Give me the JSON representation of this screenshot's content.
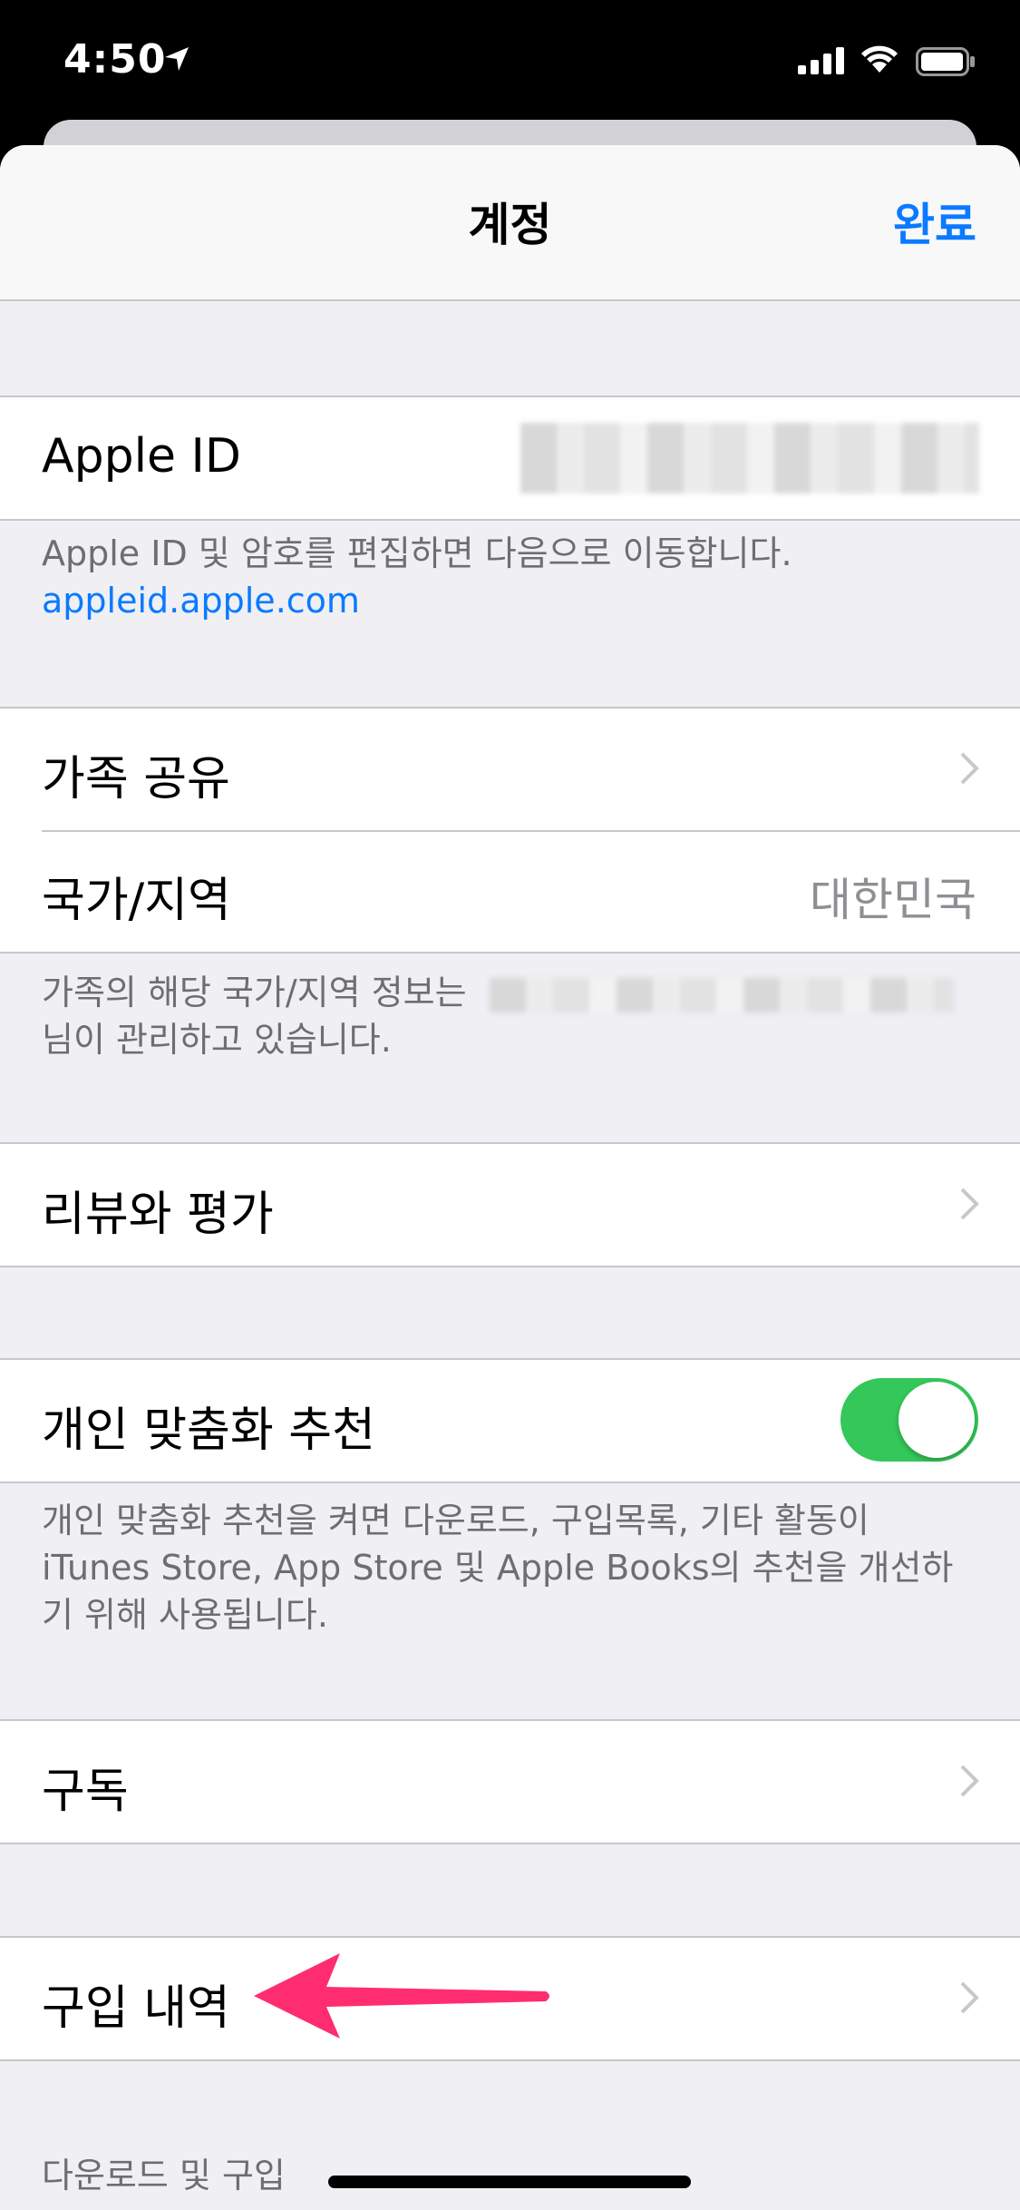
{
  "status_bar": {
    "time": "4:50"
  },
  "nav": {
    "title": "계정",
    "done": "완료"
  },
  "apple_id": {
    "label": "Apple ID",
    "footer_text": "Apple ID 및 암호를 편집하면 다음으로 이동합니다.",
    "footer_link": "appleid.apple.com"
  },
  "family": {
    "sharing_label": "가족 공유",
    "region_label": "국가/지역",
    "region_value": "대한민국",
    "footer_prefix": "가족의 해당 국가/지역 정보는",
    "footer_suffix": "님이 관리하고 있습니다."
  },
  "reviews": {
    "label": "리뷰와 평가"
  },
  "personalized": {
    "label": "개인 맞춤화 추천",
    "toggle_on": true,
    "footer": "개인 맞춤화 추천을 켜면 다운로드, 구입목록, 기타 활동이 iTunes Store, App Store 및 Apple Books의 추천을 개선하기 위해 사용됩니다."
  },
  "subscriptions": {
    "label": "구독"
  },
  "purchase_history": {
    "label": "구입 내역"
  },
  "downloads_header": "다운로드 및 구입",
  "colors": {
    "accent": "#0a7aff",
    "toggle": "#34c759",
    "annotation_arrow": "#ff2d6f"
  }
}
